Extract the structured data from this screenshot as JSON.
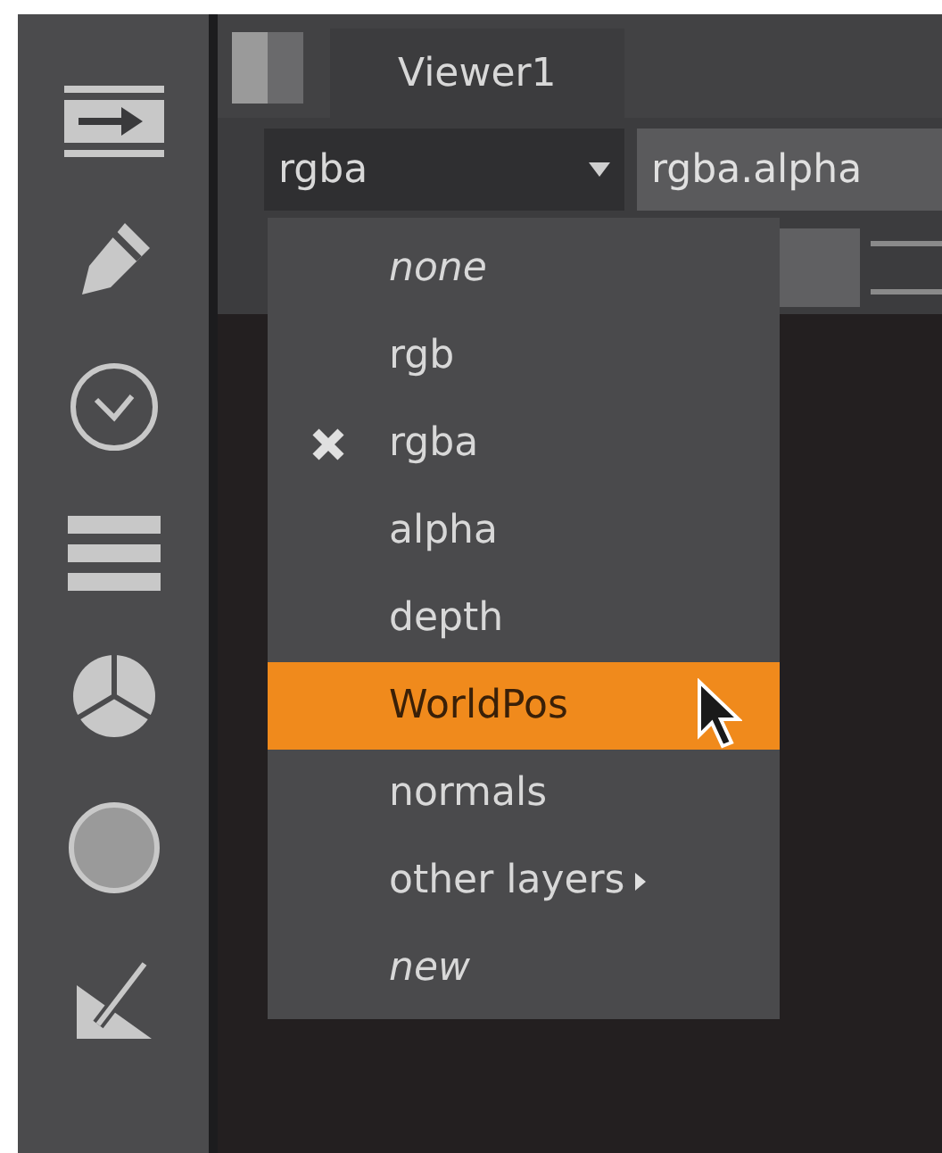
{
  "tabs": [
    {
      "label": "Viewer1",
      "selected": true
    }
  ],
  "channel_dropdown": {
    "value": "rgba"
  },
  "channel_field": {
    "value": "rgba.alpha"
  },
  "menu": {
    "items": [
      {
        "label": "none",
        "kind": "special",
        "checked": false,
        "selected": false
      },
      {
        "label": "rgb",
        "kind": "layer",
        "checked": false,
        "selected": false
      },
      {
        "label": "rgba",
        "kind": "layer",
        "checked": true,
        "selected": false
      },
      {
        "label": "alpha",
        "kind": "layer",
        "checked": false,
        "selected": false
      },
      {
        "label": "depth",
        "kind": "layer",
        "checked": false,
        "selected": false
      },
      {
        "label": "WorldPos",
        "kind": "layer",
        "checked": false,
        "selected": true
      },
      {
        "label": "normals",
        "kind": "layer",
        "checked": false,
        "selected": false
      },
      {
        "label": "other layers",
        "kind": "submenu",
        "checked": false,
        "selected": false
      },
      {
        "label": "new",
        "kind": "special",
        "checked": false,
        "selected": false
      }
    ]
  }
}
